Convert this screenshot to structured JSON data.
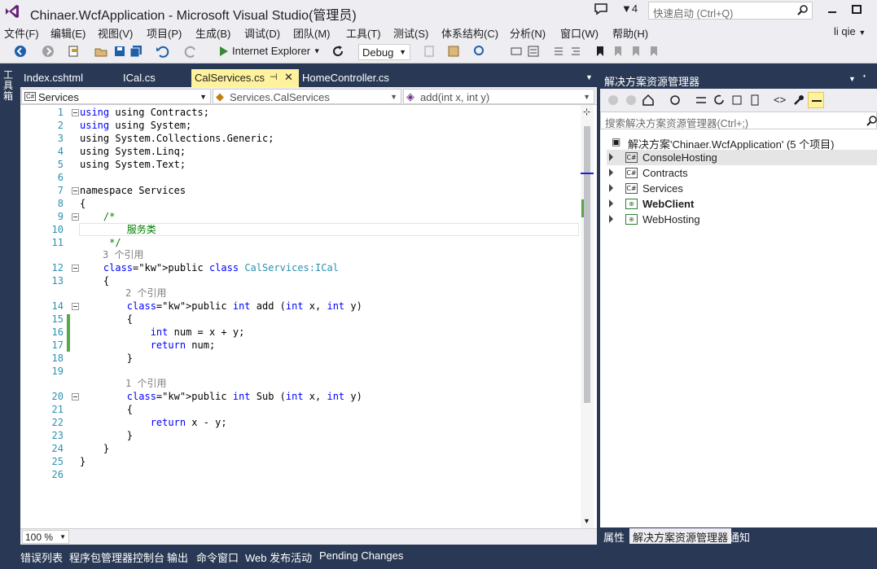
{
  "window": {
    "title": "Chinaer.WcfApplication - Microsoft Visual Studio(管理员)",
    "flag_count": "4",
    "quick_launch_placeholder": "快速启动 (Ctrl+Q)",
    "user": "li qie"
  },
  "menu": [
    "文件(F)",
    "编辑(E)",
    "视图(V)",
    "项目(P)",
    "生成(B)",
    "调试(D)",
    "团队(M)",
    "工具(T)",
    "测试(S)",
    "体系结构(C)",
    "分析(N)",
    "窗口(W)",
    "帮助(H)"
  ],
  "toolbar": {
    "run_target": "Internet Explorer",
    "configuration": "Debug"
  },
  "toolbox_label": "工具箱",
  "tabs": [
    {
      "label": "Index.cshtml"
    },
    {
      "label": "ICal.cs"
    },
    {
      "label": "CalServices.cs"
    },
    {
      "label": "HomeController.cs"
    }
  ],
  "nav": {
    "project": "Services",
    "type": "Services.CalServices",
    "member": "add(int x, int y)"
  },
  "code_lines": [
    "using Contracts;",
    "using System;",
    "using System.Collections.Generic;",
    "using System.Linq;",
    "using System.Text;",
    "",
    "namespace Services",
    "{",
    "    /*",
    "        服务类",
    "     */",
    "    public class CalServices:ICal",
    "    {",
    "        public int add (int x, int y)",
    "        {",
    "            int num = x + y;",
    "            return num;",
    "        }",
    "",
    "        public int Sub (int x, int y)",
    "        {",
    "            return x - y;",
    "        }",
    "    }",
    "}",
    ""
  ],
  "refs": {
    "class": "3 个引用",
    "add": "2 个引用",
    "sub": "1 个引用"
  },
  "zoom": "100 %",
  "solution_explorer": {
    "title": "解决方案资源管理器",
    "search_placeholder": "搜索解决方案资源管理器(Ctrl+;)",
    "root": "解决方案'Chinaer.WcfApplication' (5 个项目)",
    "projects": [
      "ConsoleHosting",
      "Contracts",
      "Services",
      "WebClient",
      "WebHosting"
    ]
  },
  "panel_tabs": [
    "属性",
    "解决方案资源管理器",
    "通知"
  ],
  "bottom_tabs": [
    "错误列表",
    "程序包管理器控制台",
    "输出",
    "命令窗口",
    "Web 发布活动",
    "Pending Changes"
  ]
}
